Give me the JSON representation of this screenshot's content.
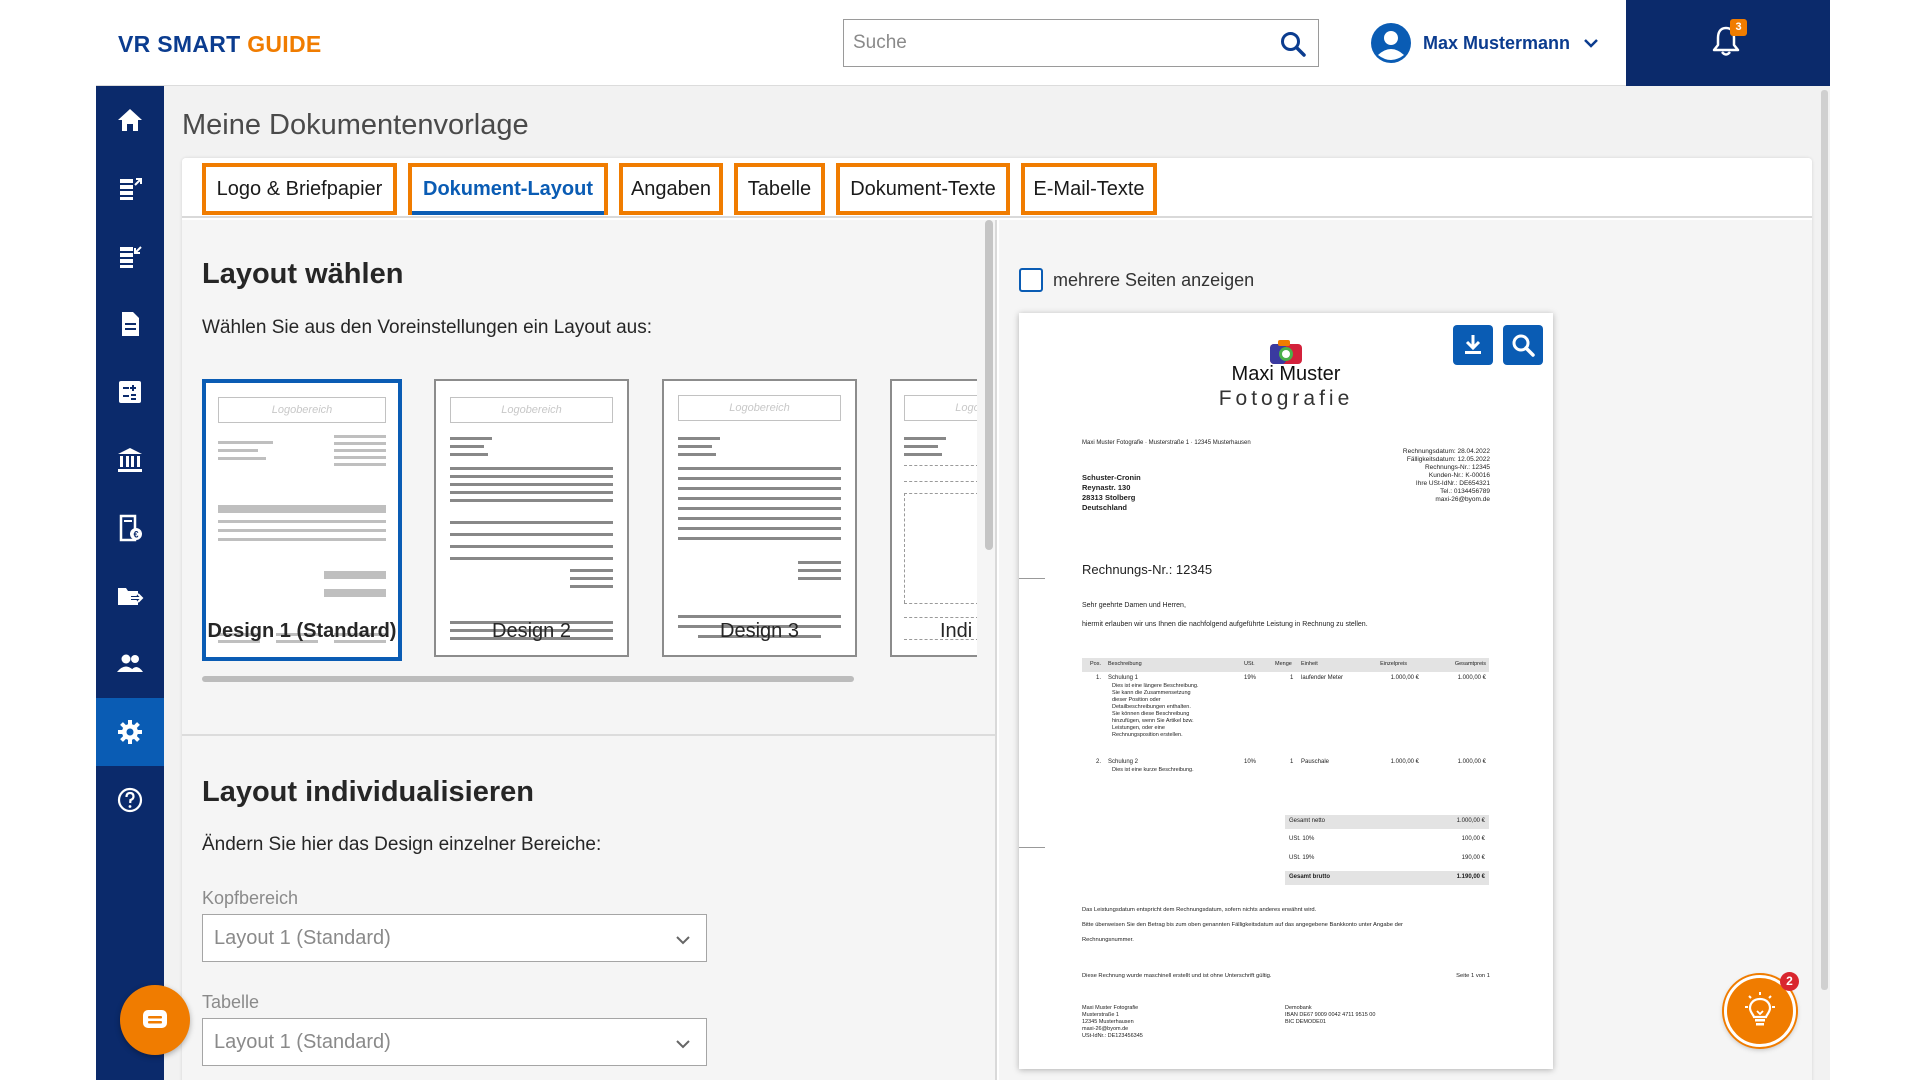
{
  "header": {
    "brand_part1": "VR SMART ",
    "brand_part2": "GUIDE",
    "search_placeholder": "Suche",
    "user_name": "Max Mustermann",
    "notification_count": "3"
  },
  "sidebar": {
    "items": [
      {
        "icon": "home-icon"
      },
      {
        "icon": "outgoing-documents-icon"
      },
      {
        "icon": "incoming-documents-icon"
      },
      {
        "icon": "document-icon"
      },
      {
        "icon": "calculator-icon"
      },
      {
        "icon": "bank-icon"
      },
      {
        "icon": "euro-document-icon"
      },
      {
        "icon": "folder-export-icon"
      },
      {
        "icon": "contacts-icon"
      },
      {
        "icon": "settings-icon",
        "active": true
      },
      {
        "icon": "help-icon"
      }
    ]
  },
  "page": {
    "title": "Meine Dokumentenvorlage"
  },
  "tabs": [
    {
      "label": "Logo & Briefpapier"
    },
    {
      "label": "Dokument-Layout",
      "active": true
    },
    {
      "label": "Angaben"
    },
    {
      "label": "Tabelle"
    },
    {
      "label": "Dokument-Texte"
    },
    {
      "label": "E-Mail-Texte"
    }
  ],
  "layout_section": {
    "heading": "Layout wählen",
    "description": "Wählen Sie aus den Voreinstellungen ein Layout aus:",
    "logo_placeholder": "Logobereich",
    "designs": [
      {
        "label": "Design 1 (Standard)",
        "selected": true
      },
      {
        "label": "Design 2"
      },
      {
        "label": "Design 3"
      },
      {
        "label": "Indi"
      }
    ]
  },
  "customize_section": {
    "heading": "Layout individualisieren",
    "description": "Ändern Sie hier das Design einzelner Bereiche:",
    "fields": [
      {
        "label": "Kopfbereich",
        "value": "Layout 1 (Standard)"
      },
      {
        "label": "Tabelle",
        "value": "Layout 1 (Standard)"
      }
    ]
  },
  "preview": {
    "multi_page_label": "mehrere Seiten anzeigen",
    "company_line1": "Maxi Muster",
    "company_line2": "Fotografie",
    "sender_line": "Maxi Muster Fotografie · Musterstraße 1 · 12345 Musterhausen",
    "recipient": [
      "Schuster-Cronin",
      "Reynastr. 130",
      "28313 Stolberg",
      "Deutschland"
    ],
    "meta": [
      "Rechnungsdatum: 28.04.2022",
      "Fälligkeitsdatum: 12.05.2022",
      "Rechnungs-Nr.: 12345",
      "Kunden-Nr.: K-00016",
      "Ihre USt-IdNr.: DE654321",
      "Tel.: 0134456789",
      "maxi-26@byom.de"
    ],
    "invoice_title": "Rechnungs-Nr.: 12345",
    "greeting": "Sehr geehrte Damen und Herren,",
    "intro": "hiermit erlauben wir uns Ihnen die nachfolgend aufgeführte Leistung in Rechnung zu stellen.",
    "table_headers": [
      "Pos.",
      "Beschreibung",
      "USt.",
      "Menge",
      "Einheit",
      "Einzelpreis",
      "Gesamtpreis"
    ],
    "rows": [
      {
        "pos": "1.",
        "desc": "Schulung 1",
        "ust": "19%",
        "menge": "1",
        "einheit": "laufender Meter",
        "einzel": "1.000,00 €",
        "gesamt": "1.000,00 €",
        "sub": [
          "Dies ist eine längere Beschreibung.",
          "Sie kann die Zusammensetzung",
          "dieser Position oder",
          "Detailbeschreibungen enthalten.",
          "Sie können diese Beschreibung",
          "hinzufügen, wenn Sie Artikel bzw.",
          "Leistungen, oder eine",
          "Rechnungsposition erstellen."
        ]
      },
      {
        "pos": "2.",
        "desc": "Schulung 2",
        "ust": "10%",
        "menge": "1",
        "einheit": "Pauschale",
        "einzel": "1.000,00 €",
        "gesamt": "1.000,00 €",
        "sub": [
          "Dies ist eine kurze Beschreibung."
        ]
      }
    ],
    "totals": [
      {
        "label": "Gesamt netto",
        "value": "1.000,00 €"
      },
      {
        "label": "USt. 10%",
        "value": "100,00 €"
      },
      {
        "label": "USt. 19%",
        "value": "190,00 €"
      },
      {
        "label": "Gesamt brutto",
        "value": "1.190,00 €"
      }
    ],
    "note1": "Das Leistungsdatum entspricht dem Rechnungsdatum, sofern nichts anderes erwähnt wird.",
    "note2": "Bitte überweisen Sie den Betrag bis zum oben genannten Fälligkeitsdatum auf das angegebene Bankkonto unter Angabe der",
    "note3": "Rechnungsnummer.",
    "note4": "Diese Rechnung wurde maschinell erstellt und ist ohne Unterschrift gültig.",
    "page_info": "Seite 1 von 1",
    "footer_left": [
      "Maxi Muster Fotografie",
      "Musterstraße 1",
      "12345 Musterhausen",
      "maxi-26@byom.de",
      "USt-IdNr.: DE123456345"
    ],
    "footer_right": [
      "Demobank",
      "IBAN DE67 9009 0042 4711 9515 00",
      "BIC DEMODE01"
    ]
  },
  "floating": {
    "tips_count": "2"
  },
  "colors": {
    "brand_blue": "#0b3c8f",
    "accent_orange": "#f07c00",
    "nav_dark": "#0b2a6b",
    "active_blue": "#0a5cb4"
  }
}
